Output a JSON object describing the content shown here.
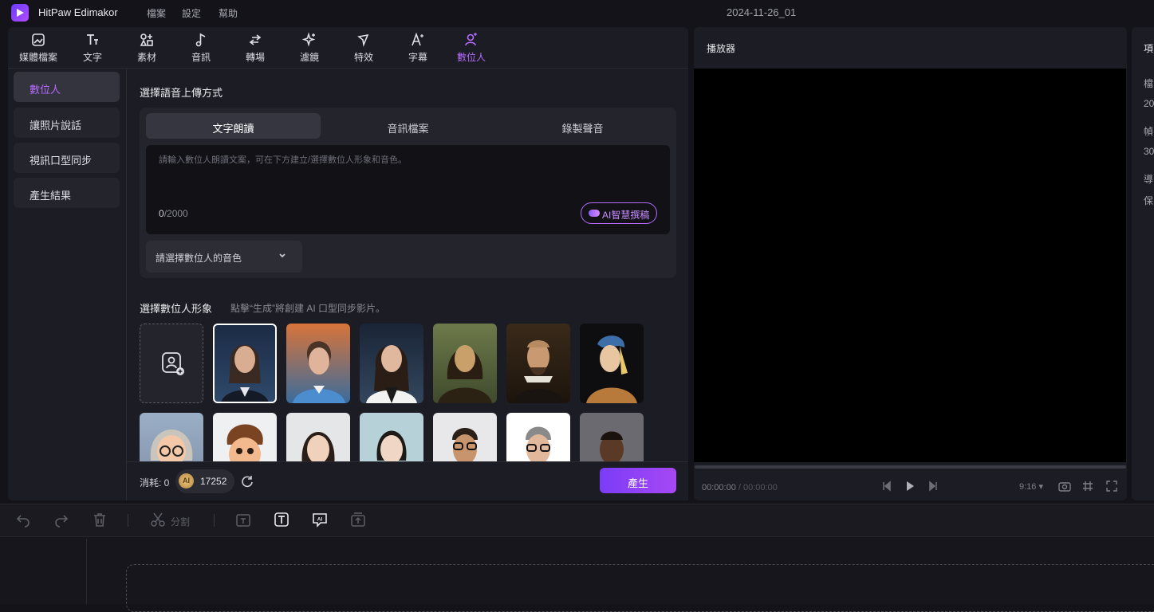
{
  "app": {
    "name": "HitPaw Edimakor",
    "menu": [
      "檔案",
      "設定",
      "幫助"
    ],
    "project": "2024-11-26_01"
  },
  "toolbar": {
    "items": [
      {
        "label": "媒體檔案",
        "icon": "media-icon"
      },
      {
        "label": "文字",
        "icon": "text-icon"
      },
      {
        "label": "素材",
        "icon": "assets-icon"
      },
      {
        "label": "音訊",
        "icon": "music-icon"
      },
      {
        "label": "轉場",
        "icon": "transition-icon"
      },
      {
        "label": "濾鏡",
        "icon": "filter-icon"
      },
      {
        "label": "特效",
        "icon": "effect-icon"
      },
      {
        "label": "字幕",
        "icon": "subtitle-icon"
      },
      {
        "label": "數位人",
        "icon": "digital-human-icon"
      }
    ],
    "active": "數位人"
  },
  "subnav": {
    "items": [
      "數位人",
      "讓照片說話",
      "視訊口型同步",
      "產生結果"
    ],
    "active": "數位人"
  },
  "upload": {
    "title": "選擇語音上傳方式",
    "tabs": [
      "文字朗讀",
      "音訊檔案",
      "錄製聲音"
    ],
    "active_tab": "文字朗讀",
    "placeholder": "請輸入數位人朗讀文案，可在下方建立/選擇數位人形象和音色。",
    "count_current": "0",
    "count_max": "/2000",
    "ai_button": "AI智慧撰稿",
    "voice_select": "請選擇數位人的音色"
  },
  "avatar": {
    "title": "選擇數位人形象",
    "hint": "點擊“生成”將創建 AI 口型同步影片。"
  },
  "footer": {
    "consume": "消耗: 0",
    "coin": "AI",
    "credits": "17252",
    "generate": "產生"
  },
  "player": {
    "title": "播放器",
    "current_time": "00:00:00",
    "total_time": " / 00:00:00",
    "ratio": "9:16 ▾"
  },
  "right_panel": {
    "lines": [
      "檔",
      "20",
      "幀",
      "30",
      "導",
      "保"
    ]
  },
  "timeline": {
    "split": "分割"
  },
  "colors": {
    "accent": "#b66cff",
    "bg": "#131319",
    "panel": "#1c1c24",
    "generate_start": "#7b3cf7",
    "generate_end": "#a648f5"
  }
}
